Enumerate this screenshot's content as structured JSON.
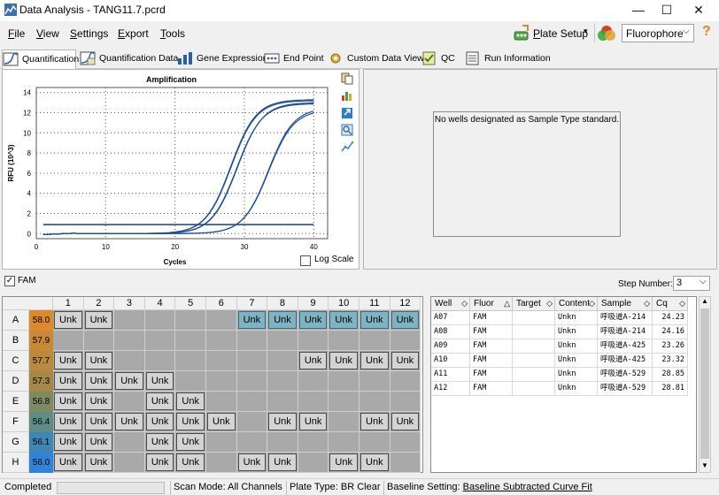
{
  "window": {
    "title": "Data Analysis - TANG11.7.pcrd"
  },
  "menu": [
    {
      "label": "File",
      "accel": "F",
      "rest": "ile"
    },
    {
      "label": "View",
      "accel": "V",
      "rest": "iew"
    },
    {
      "label": "Settings",
      "accel": "S",
      "rest": "ettings"
    },
    {
      "label": "Export",
      "accel": "E",
      "rest": "xport"
    },
    {
      "label": "Tools",
      "accel": "T",
      "rest": "ools"
    }
  ],
  "toolbar": {
    "plate_setup": "Plate Setup",
    "plate_setup_accel": "P",
    "plate_setup_rest": "late Setup",
    "fluorophore_value": "Fluorophore"
  },
  "tabs": [
    "Quantification",
    "Quantification Data",
    "Gene Expression",
    "End Point",
    "Custom Data View",
    "QC",
    "Run Information"
  ],
  "chart": {
    "title": "Amplification",
    "xlabel": "Cycles",
    "ylabel": "RFU (10^3)",
    "log_scale_label": "Log Scale",
    "log_scale_checked": false
  },
  "chart_data": {
    "type": "line",
    "title": "Amplification",
    "xlabel": "Cycles",
    "ylabel": "RFU (10^3)",
    "xlim": [
      0,
      42
    ],
    "ylim": [
      -0.5,
      14.5
    ],
    "xticks": [
      0,
      10,
      20,
      30,
      40
    ],
    "yticks": [
      0,
      2,
      4,
      6,
      8,
      10,
      12,
      14
    ],
    "threshold": 0.9,
    "grid": true,
    "series": [
      {
        "cq": 23.32,
        "plateau": 13.2
      },
      {
        "cq": 23.26,
        "plateau": 13.3
      },
      {
        "cq": 24.16,
        "plateau": 12.9
      },
      {
        "cq": 24.23,
        "plateau": 13.0
      },
      {
        "cq": 28.81,
        "plateau": 12.5
      },
      {
        "cq": 28.85,
        "plateau": 12.3
      }
    ]
  },
  "standard_panel": {
    "message": "No wells designated as Sample Type standard."
  },
  "fam_bar": {
    "label": "FAM",
    "checked": true,
    "step_label": "Step Number:",
    "step_value": "3"
  },
  "plate": {
    "columns": [
      "1",
      "2",
      "3",
      "4",
      "5",
      "6",
      "7",
      "8",
      "9",
      "10",
      "11",
      "12"
    ],
    "rows": [
      {
        "label": "A",
        "temp": "58.0",
        "temp_color": "#dd8a2a",
        "wells": [
          "Unk",
          "Unk",
          "",
          "",
          "",
          "",
          "Unk",
          "Unk",
          "Unk",
          "Unk",
          "Unk",
          "Unk"
        ],
        "selected": [
          false,
          false,
          false,
          false,
          false,
          false,
          true,
          true,
          true,
          true,
          true,
          true
        ]
      },
      {
        "label": "B",
        "temp": "57.9",
        "temp_color": "#c98a38",
        "wells": [
          "",
          "",
          "",
          "",
          "",
          "",
          "",
          "",
          "",
          "",
          "",
          ""
        ],
        "selected": [
          false,
          false,
          false,
          false,
          false,
          false,
          false,
          false,
          false,
          false,
          false,
          false
        ]
      },
      {
        "label": "C",
        "temp": "57.7",
        "temp_color": "#b8893f",
        "wells": [
          "Unk",
          "Unk",
          "",
          "",
          "",
          "",
          "",
          "",
          "Unk",
          "Unk",
          "Unk",
          "Unk"
        ],
        "selected": [
          false,
          false,
          false,
          false,
          false,
          false,
          false,
          false,
          false,
          false,
          false,
          false
        ]
      },
      {
        "label": "D",
        "temp": "57.3",
        "temp_color": "#a58848",
        "wells": [
          "Unk",
          "Unk",
          "Unk",
          "Unk",
          "",
          "",
          "",
          "",
          "",
          "",
          "",
          ""
        ],
        "selected": [
          false,
          false,
          false,
          false,
          false,
          false,
          false,
          false,
          false,
          false,
          false,
          false
        ]
      },
      {
        "label": "E",
        "temp": "56.8",
        "temp_color": "#808a62",
        "wells": [
          "Unk",
          "Unk",
          "",
          "Unk",
          "Unk",
          "",
          "",
          "",
          "",
          "",
          "",
          ""
        ],
        "selected": [
          false,
          false,
          false,
          false,
          false,
          false,
          false,
          false,
          false,
          false,
          false,
          false
        ]
      },
      {
        "label": "F",
        "temp": "56.4",
        "temp_color": "#5d8d86",
        "wells": [
          "Unk",
          "Unk",
          "Unk",
          "Unk",
          "Unk",
          "Unk",
          "",
          "Unk",
          "Unk",
          "",
          "Unk",
          "Unk"
        ],
        "selected": [
          false,
          false,
          false,
          false,
          false,
          false,
          false,
          false,
          false,
          false,
          false,
          false
        ]
      },
      {
        "label": "G",
        "temp": "56.1",
        "temp_color": "#3e86b5",
        "wells": [
          "Unk",
          "Unk",
          "",
          "Unk",
          "Unk",
          "",
          "",
          "",
          "",
          "",
          "",
          ""
        ],
        "selected": [
          false,
          false,
          false,
          false,
          false,
          false,
          false,
          false,
          false,
          false,
          false,
          false
        ]
      },
      {
        "label": "H",
        "temp": "56.0",
        "temp_color": "#2f83d8",
        "wells": [
          "Unk",
          "Unk",
          "",
          "Unk",
          "Unk",
          "",
          "Unk",
          "Unk",
          "",
          "Unk",
          "Unk",
          ""
        ],
        "selected": [
          false,
          false,
          false,
          false,
          false,
          false,
          false,
          false,
          false,
          false,
          false,
          false
        ]
      }
    ]
  },
  "results": {
    "headers": [
      "Well",
      "Fluor",
      "Target",
      "Content",
      "Sample",
      "Cq"
    ],
    "rows": [
      [
        "A07",
        "FAM",
        "",
        "Unkn",
        "呼吸道A-214",
        "24.23"
      ],
      [
        "A08",
        "FAM",
        "",
        "Unkn",
        "呼吸道A-214",
        "24.16"
      ],
      [
        "A09",
        "FAM",
        "",
        "Unkn",
        "呼吸道A-425",
        "23.26"
      ],
      [
        "A10",
        "FAM",
        "",
        "Unkn",
        "呼吸道A-425",
        "23.32"
      ],
      [
        "A11",
        "FAM",
        "",
        "Unkn",
        "呼吸道A-529",
        "28.85"
      ],
      [
        "A12",
        "FAM",
        "",
        "Unkn",
        "呼吸道A-529",
        "28.81"
      ]
    ]
  },
  "status": {
    "completed": "Completed",
    "scan_mode": "Scan Mode: All Channels",
    "plate_type": "Plate Type: BR Clear",
    "baseline_prefix": "Baseline Setting: ",
    "baseline_value": "Baseline Subtracted Curve Fit"
  },
  "colors": {
    "curve": "#1f4e96",
    "threshold": "#1f4e96",
    "selected_well": "#7fb3c4"
  }
}
